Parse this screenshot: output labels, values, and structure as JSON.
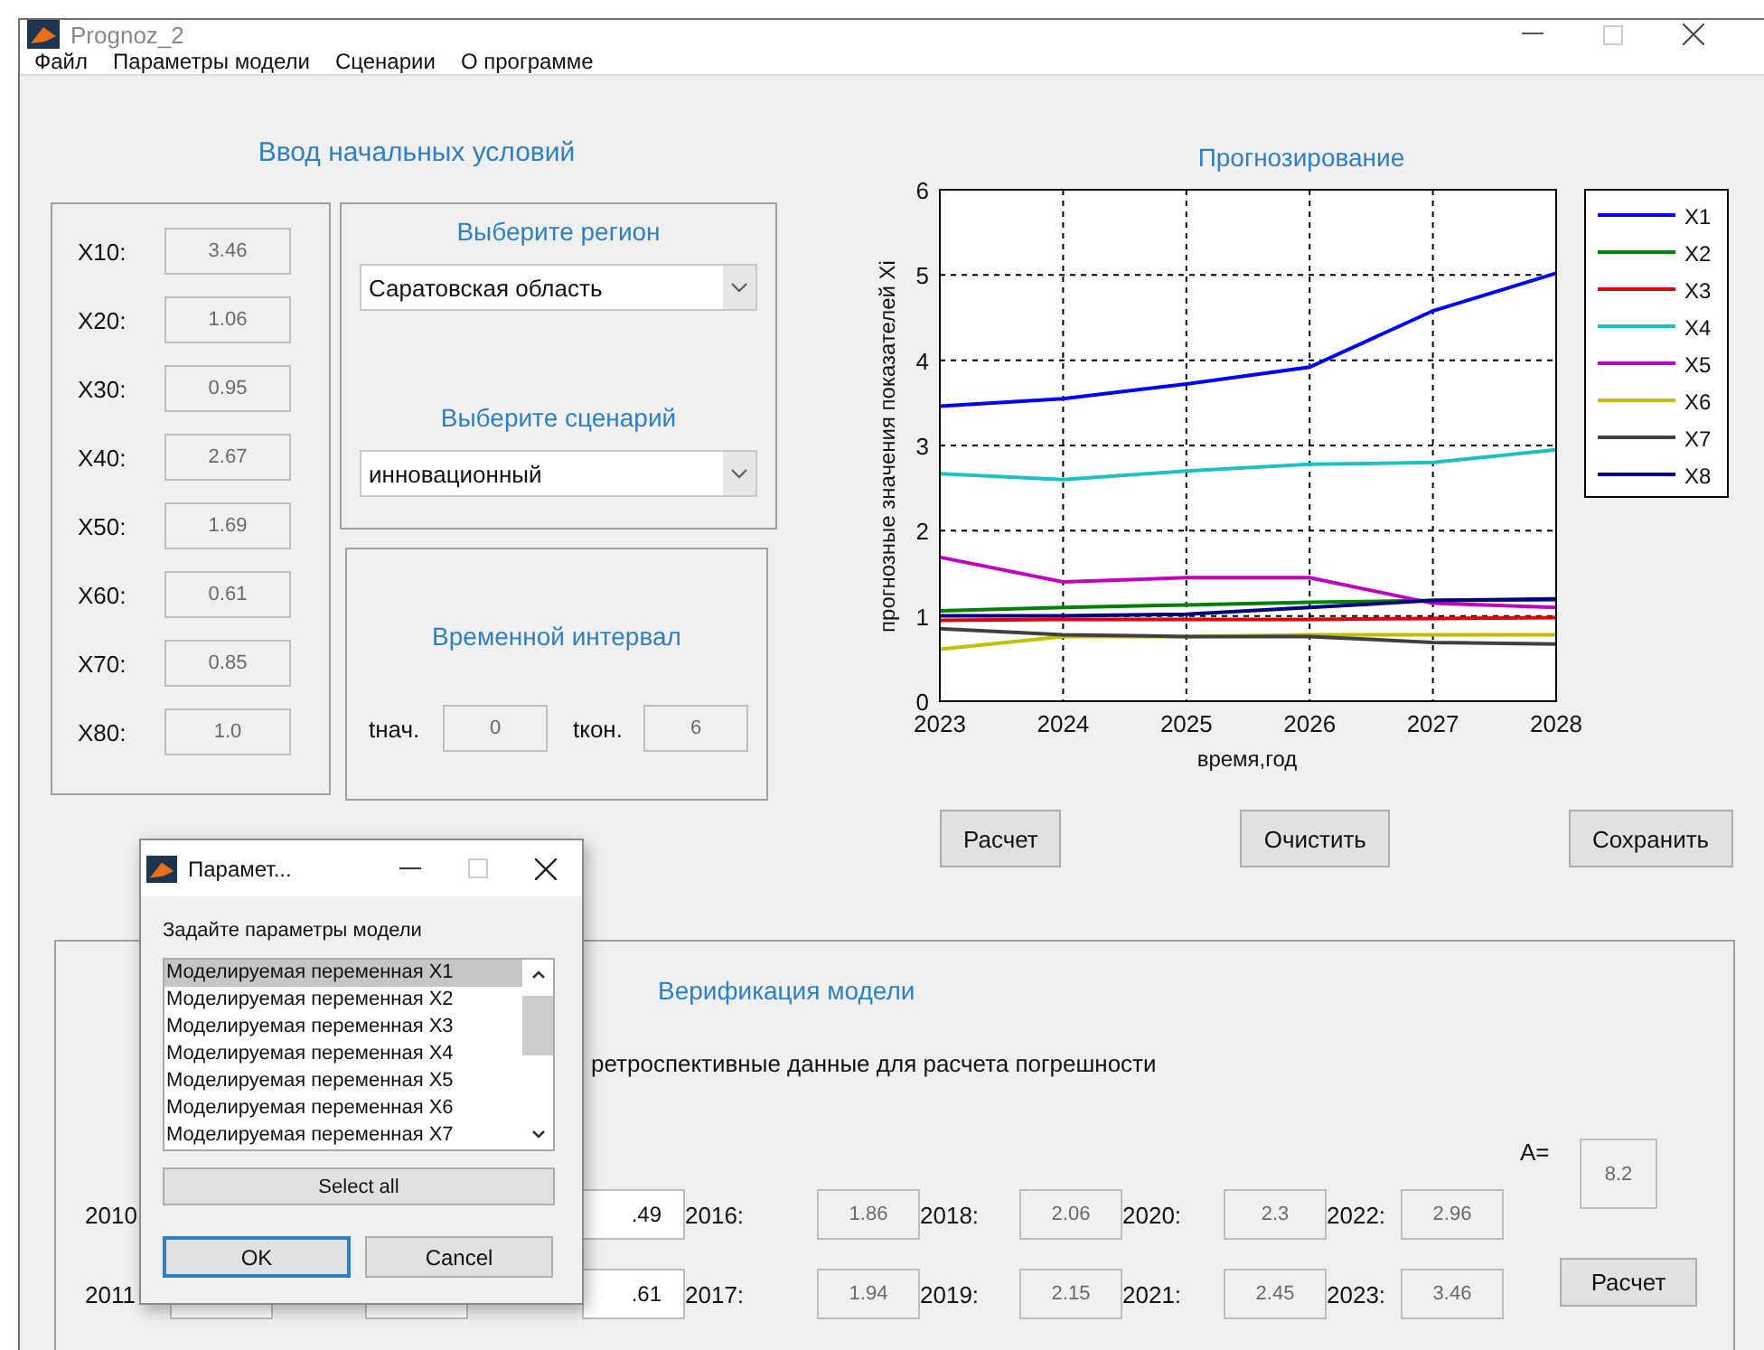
{
  "window": {
    "title": "Prognoz_2"
  },
  "menu": [
    {
      "label": "Файл"
    },
    {
      "label": "Параметры модели"
    },
    {
      "label": "Сценарии"
    },
    {
      "label": "О программе"
    }
  ],
  "initial_conditions": {
    "title": "Ввод начальных условий",
    "fields": [
      {
        "label": "X10:",
        "value": "3.46"
      },
      {
        "label": "X20:",
        "value": "1.06"
      },
      {
        "label": "X30:",
        "value": "0.95"
      },
      {
        "label": "X40:",
        "value": "2.67"
      },
      {
        "label": "X50:",
        "value": "1.69"
      },
      {
        "label": "X60:",
        "value": "0.61"
      },
      {
        "label": "X70:",
        "value": "0.85"
      },
      {
        "label": "X80:",
        "value": "1.0"
      }
    ]
  },
  "region": {
    "title": "Выберите регион",
    "value": "Саратовская область"
  },
  "scenario": {
    "title": "Выберите сценарий",
    "value": "инновационный"
  },
  "interval": {
    "title": "Временной интервал",
    "start_label": "tнач.",
    "start": "0",
    "end_label": "tкон.",
    "end": "6"
  },
  "forecast": {
    "title": "Прогнозирование",
    "chart_data": {
      "type": "line",
      "xlabel": "время,год",
      "ylabel": "прогнозные значения показателей Xi",
      "x": [
        2023,
        2024,
        2025,
        2026,
        2027,
        2028
      ],
      "xlim": [
        2023,
        2028
      ],
      "ylim": [
        0,
        6
      ],
      "xticks": [
        2023,
        2024,
        2025,
        2026,
        2027,
        2028
      ],
      "yticks": [
        0,
        1,
        2,
        3,
        4,
        5,
        6
      ],
      "grid": true,
      "legend": true,
      "series": [
        {
          "name": "X1",
          "color": "#0000ff",
          "values": [
            3.46,
            3.55,
            3.72,
            3.92,
            4.58,
            5.02
          ]
        },
        {
          "name": "X2",
          "color": "#008000",
          "values": [
            1.06,
            1.1,
            1.13,
            1.16,
            1.18,
            1.19
          ]
        },
        {
          "name": "X3",
          "color": "#e00000",
          "values": [
            0.95,
            0.96,
            0.96,
            0.96,
            0.97,
            0.98
          ]
        },
        {
          "name": "X4",
          "color": "#20c0c0",
          "values": [
            2.67,
            2.6,
            2.7,
            2.78,
            2.8,
            2.95
          ]
        },
        {
          "name": "X5",
          "color": "#c000c0",
          "values": [
            1.69,
            1.4,
            1.45,
            1.45,
            1.15,
            1.1
          ]
        },
        {
          "name": "X6",
          "color": "#c0c000",
          "values": [
            0.61,
            0.76,
            0.76,
            0.78,
            0.78,
            0.78
          ]
        },
        {
          "name": "X7",
          "color": "#404040",
          "values": [
            0.85,
            0.78,
            0.76,
            0.76,
            0.69,
            0.67
          ]
        },
        {
          "name": "X8",
          "color": "#000080",
          "values": [
            1.0,
            1.0,
            1.02,
            1.1,
            1.18,
            1.2
          ]
        }
      ]
    }
  },
  "actions": [
    {
      "label": "Расчет"
    },
    {
      "label": "Очистить"
    },
    {
      "label": "Сохранить"
    }
  ],
  "verification": {
    "title": "Верификация модели",
    "note": "ретроспективные данные для расчета погрешности",
    "rows": [
      [
        {
          "label": "2010"
        },
        {},
        {
          "value": ".49"
        },
        {
          "label": "2016:",
          "value": "1.86"
        },
        {
          "label": "2018:",
          "value": "2.06"
        },
        {
          "label": "2020:",
          "value": "2.3"
        },
        {
          "label": "2022:",
          "value": "2.96"
        }
      ],
      [
        {
          "label": "2011",
          "field": true
        },
        {
          "field": true
        },
        {
          "value": ".61"
        },
        {
          "label": "2017:",
          "value": "1.94"
        },
        {
          "label": "2019:",
          "value": "2.15"
        },
        {
          "label": "2021:",
          "value": "2.45"
        },
        {
          "label": "2023:",
          "value": "3.46"
        }
      ]
    ],
    "a_label": "A=",
    "a_value": "8.2",
    "button": "Расчет"
  },
  "dialog": {
    "title": "Парамет...",
    "prompt": "Задайте параметры модели",
    "items": [
      {
        "label": "Моделируемая переменная X1",
        "selected": true
      },
      {
        "label": "Моделируемая переменная X2",
        "selected": false
      },
      {
        "label": "Моделируемая переменная X3",
        "selected": false
      },
      {
        "label": "Моделируемая переменная X4",
        "selected": false
      },
      {
        "label": "Моделируемая переменная X5",
        "selected": false
      },
      {
        "label": "Моделируемая переменная X6",
        "selected": false
      },
      {
        "label": "Моделируемая переменная X7",
        "selected": false
      }
    ],
    "select_all": "Select all",
    "ok": "OK",
    "cancel": "Cancel"
  }
}
